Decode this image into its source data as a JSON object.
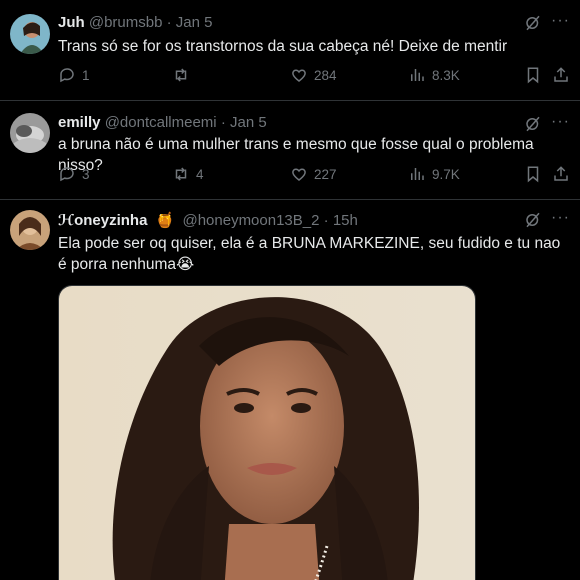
{
  "replies": [
    {
      "name": "Juh",
      "handle": "@brumsbb",
      "sep": "·",
      "time": "Jan 5",
      "text": "Trans só se for os transtornos da sua cabeça né! Deixe de mentir",
      "replies": "1",
      "reposts": "",
      "likes": "284",
      "views": "8.3K"
    },
    {
      "name": "emilly",
      "handle": "@dontcallmeemi",
      "sep": "·",
      "time": "Jan 5",
      "text": "a bruna não é uma mulher trans e mesmo que fosse qual o problema nisso?",
      "replies": "3",
      "reposts": "4",
      "likes": "227",
      "views": "9.7K"
    },
    {
      "name": "ℋoneyzinha",
      "handle": "@honeymoon13B_2",
      "sep": "·",
      "time": "15h",
      "text": "Ela pode ser oq quiser, ela é a BRUNA MARKEZINE, seu fudido e tu nao é porra nenhuma😭",
      "badge_emoji": "🍯"
    }
  ],
  "icons": {
    "reply": "reply-icon",
    "repost": "repost-icon",
    "like": "heart-icon",
    "views": "views-icon",
    "bookmark": "bookmark-icon",
    "share": "share-icon",
    "grok": "grok-icon",
    "more": "more-icon"
  },
  "colors": {
    "background": "#000000",
    "text": "#e7e9ea",
    "muted": "#71767b",
    "divider": "#2f3336"
  }
}
